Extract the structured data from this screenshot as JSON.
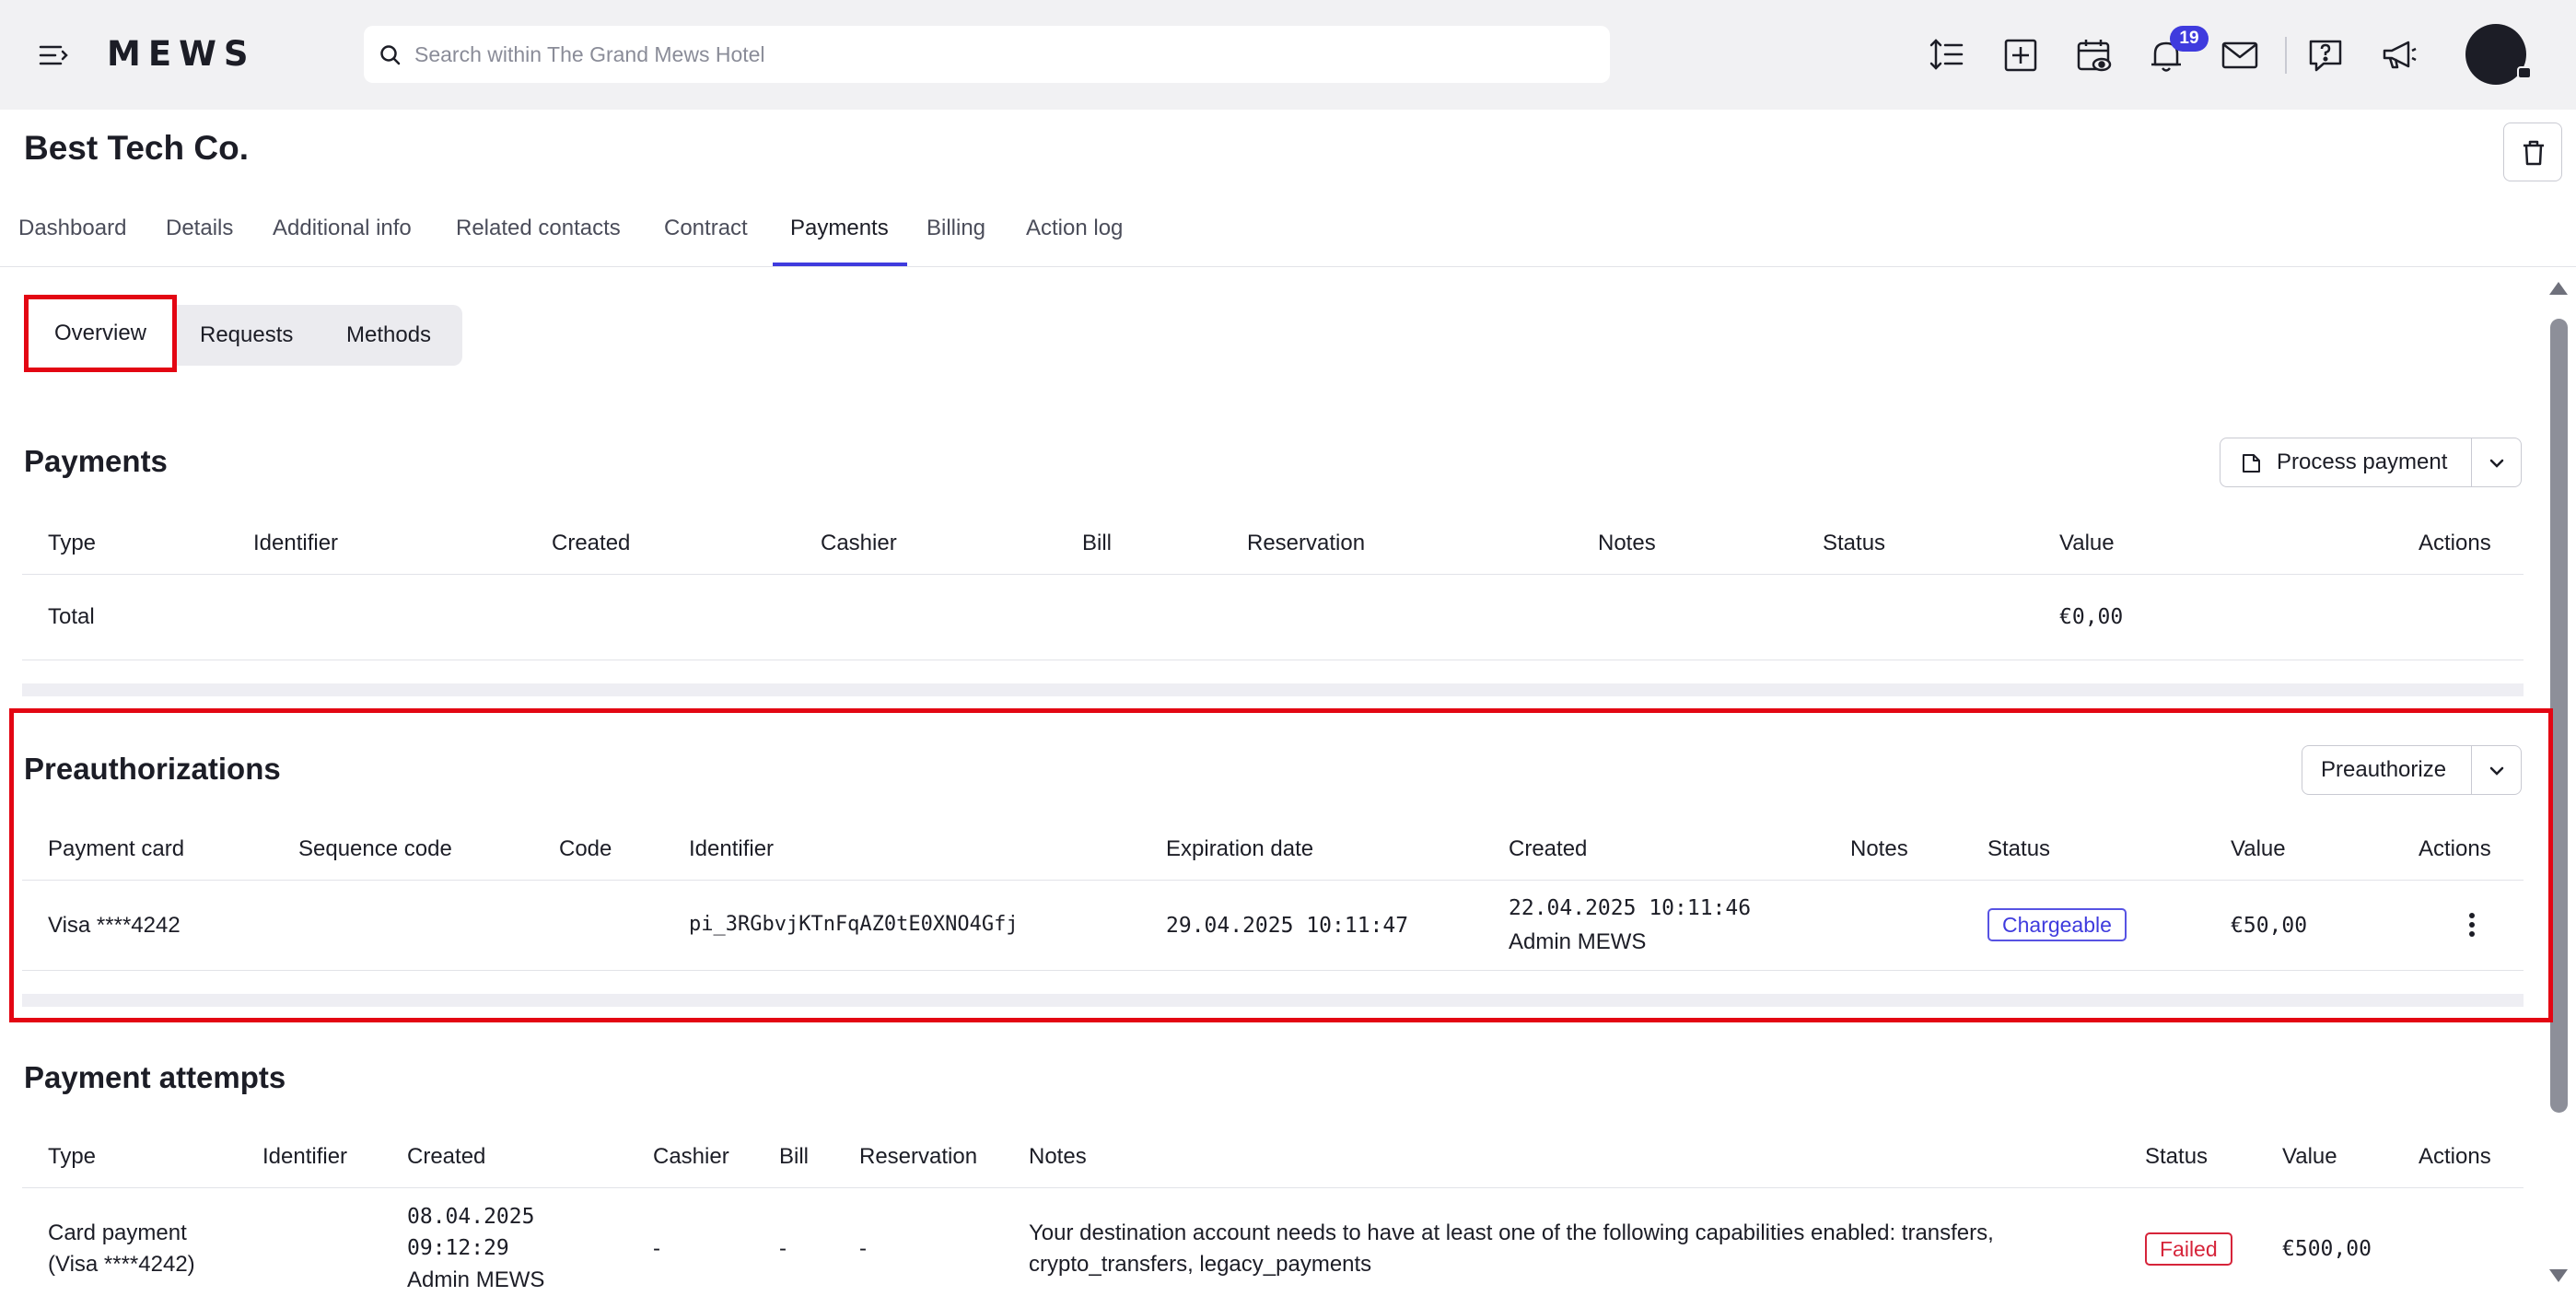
{
  "topbar": {
    "logo": "MEWS",
    "search_placeholder": "Search within The Grand Mews Hotel",
    "notification_count": "19",
    "icons": [
      "sort-icon",
      "add-icon",
      "calendar-view-icon",
      "bell-icon",
      "mail-icon",
      "help-icon",
      "megaphone-icon"
    ]
  },
  "page": {
    "title": "Best Tech Co."
  },
  "tabs": [
    "Dashboard",
    "Details",
    "Additional info",
    "Related contacts",
    "Contract",
    "Payments",
    "Billing",
    "Action log"
  ],
  "active_tab": "Payments",
  "subtabs": [
    "Overview",
    "Requests",
    "Methods"
  ],
  "active_subtab": "Overview",
  "payments": {
    "title": "Payments",
    "action_button": "Process payment",
    "columns": [
      "Type",
      "Identifier",
      "Created",
      "Cashier",
      "Bill",
      "Reservation",
      "Notes",
      "Status",
      "Value",
      "Actions"
    ],
    "total_label": "Total",
    "total_value": "€0,00"
  },
  "preauthorizations": {
    "title": "Preauthorizations",
    "action_button": "Preauthorize",
    "columns": [
      "Payment card",
      "Sequence code",
      "Code",
      "Identifier",
      "Expiration date",
      "Created",
      "Notes",
      "Status",
      "Value",
      "Actions"
    ],
    "rows": [
      {
        "payment_card": "Visa ****4242",
        "sequence_code": "",
        "code": "",
        "identifier": "pi_3RGbvjKTnFqAZ0tE0XNO4Gfj",
        "expiration_date": "29.04.2025 10:11:47",
        "created_date": "22.04.2025 10:11:46",
        "created_by": "Admin MEWS",
        "notes": "",
        "status": "Chargeable",
        "value": "€50,00"
      }
    ]
  },
  "payment_attempts": {
    "title": "Payment attempts",
    "columns": [
      "Type",
      "Identifier",
      "Created",
      "Cashier",
      "Bill",
      "Reservation",
      "Notes",
      "Status",
      "Value",
      "Actions"
    ],
    "rows": [
      {
        "type_line1": "Card payment",
        "type_line2": "(Visa ****4242)",
        "identifier": "",
        "created_date": "08.04.2025",
        "created_time": "09:12:29",
        "created_by": "Admin MEWS",
        "cashier": "-",
        "bill": "-",
        "reservation": "-",
        "notes_line1": "Your destination account needs to have at least one of the following capabilities enabled: transfers,",
        "notes_line2": "crypto_transfers, legacy_payments",
        "status": "Failed",
        "value": "€500,00"
      }
    ]
  },
  "colors": {
    "accent": "#3f3bde",
    "highlight": "#e30613",
    "failed": "#d6243a",
    "topbar_bg": "#f1f1f3"
  }
}
